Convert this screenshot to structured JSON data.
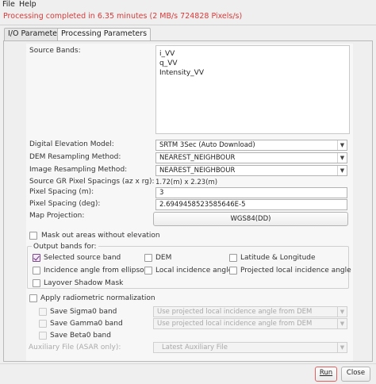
{
  "menu": {
    "file": "File",
    "help": "Help"
  },
  "status_text": "Processing completed in 6.35 minutes (2 MB/s 724828 Pixels/s)",
  "tabs": [
    {
      "label": "I/O Parameters",
      "active": false
    },
    {
      "label": "Processing Parameters",
      "active": true
    }
  ],
  "source_bands": {
    "label": "Source Bands:",
    "items": [
      "i_VV",
      "q_VV",
      "Intensity_VV"
    ]
  },
  "dem": {
    "label": "Digital Elevation Model:",
    "value": "SRTM 3Sec (Auto Download)"
  },
  "dem_resampling": {
    "label": "DEM Resampling Method:",
    "value": "NEAREST_NEIGHBOUR"
  },
  "image_resampling": {
    "label": "Image Resampling Method:",
    "value": "NEAREST_NEIGHBOUR"
  },
  "source_gr_spacing": {
    "label": "Source GR Pixel Spacings (az x rg):",
    "value": "1.72(m) x 2.23(m)"
  },
  "pixel_spacing_m": {
    "label": "Pixel Spacing (m):",
    "value": "3"
  },
  "pixel_spacing_deg": {
    "label": "Pixel Spacing (deg):",
    "value": "2.6949458523585646E-5"
  },
  "map_projection": {
    "label": "Map Projection:",
    "value": "WGS84(DD)"
  },
  "mask_out": {
    "label": "Mask out areas without elevation",
    "checked": false
  },
  "output_bands": {
    "title": "Output bands for:",
    "selected_source_band": {
      "label": "Selected source band",
      "checked": true
    },
    "dem": {
      "label": "DEM",
      "checked": false
    },
    "lat_lon": {
      "label": "Latitude & Longitude",
      "checked": false
    },
    "incidence_ellipsoid": {
      "label": "Incidence angle from ellipsoid",
      "checked": false
    },
    "local_incidence": {
      "label": "Local incidence angle",
      "checked": false
    },
    "projected_local_incidence": {
      "label": "Projected local incidence angle",
      "checked": false
    },
    "layover_shadow": {
      "label": "Layover Shadow Mask",
      "checked": false
    }
  },
  "radiometric": {
    "label": "Apply radiometric normalization",
    "checked": false,
    "sigma0": {
      "label": "Save Sigma0 band",
      "combo": "Use projected local incidence angle from DEM"
    },
    "gamma0": {
      "label": "Save Gamma0 band",
      "combo": "Use projected local incidence angle from DEM"
    },
    "beta0": {
      "label": "Save Beta0 band"
    },
    "aux_file": {
      "label": "Auxiliary File (ASAR only):",
      "value": "Latest Auxiliary File"
    }
  },
  "buttons": {
    "run": "Run",
    "close": "Close"
  },
  "colors": {
    "status": "#d83a3a",
    "checkbox_accent": "#6a2f7a",
    "run_border": "#e06060"
  }
}
